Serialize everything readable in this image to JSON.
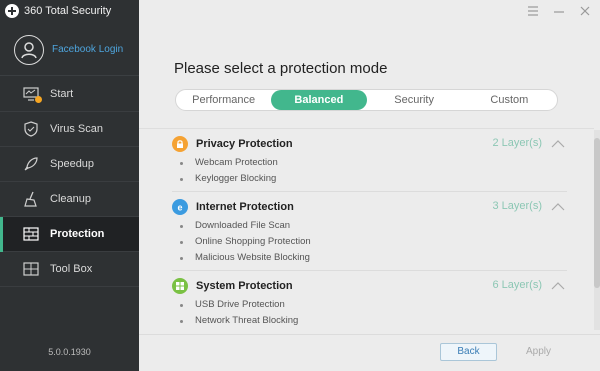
{
  "app": {
    "title": "360 Total Security",
    "version": "5.0.0.1930"
  },
  "profile": {
    "login_label": "Facebook Login"
  },
  "sidebar": {
    "items": [
      {
        "label": "Start",
        "icon": "monitor-icon",
        "active": false
      },
      {
        "label": "Virus Scan",
        "icon": "shield-icon",
        "active": false
      },
      {
        "label": "Speedup",
        "icon": "rocket-icon",
        "active": false
      },
      {
        "label": "Cleanup",
        "icon": "broom-icon",
        "active": false
      },
      {
        "label": "Protection",
        "icon": "firewall-icon",
        "active": true
      },
      {
        "label": "Tool Box",
        "icon": "toolbox-icon",
        "active": false
      }
    ]
  },
  "main": {
    "heading": "Please select a protection mode",
    "modes": [
      "Performance",
      "Balanced",
      "Security",
      "Custom"
    ],
    "selected_mode": "Balanced",
    "sections": [
      {
        "title": "Privacy Protection",
        "layers": "2 Layer(s)",
        "icon": "lock-icon",
        "icon_color": "#f5a233",
        "items": [
          "Webcam Protection",
          "Keylogger Blocking"
        ]
      },
      {
        "title": "Internet Protection",
        "layers": "3 Layer(s)",
        "icon": "browser-icon",
        "icon_color": "#3b9be0",
        "items": [
          "Downloaded File Scan",
          "Online Shopping Protection",
          "Malicious Website Blocking"
        ]
      },
      {
        "title": "System Protection",
        "layers": "6 Layer(s)",
        "icon": "windows-icon",
        "icon_color": "#7ac143",
        "items": [
          "USB Drive Protection",
          "Network Threat Blocking"
        ]
      }
    ]
  },
  "footer": {
    "back_label": "Back",
    "apply_label": "Apply"
  },
  "colors": {
    "accent": "#42b78d",
    "sidebar_bg": "#2e3133",
    "link": "#4ea5de"
  }
}
